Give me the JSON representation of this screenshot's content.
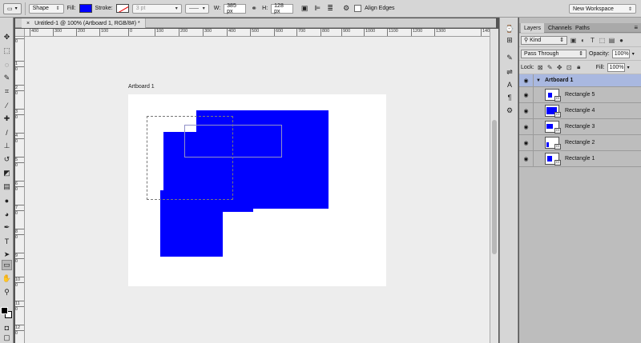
{
  "options_bar": {
    "tool_mode": "Shape",
    "fill_label": "Fill:",
    "stroke_label": "Stroke:",
    "stroke_width": "3 pt",
    "width_label": "W:",
    "width_value": "385 px",
    "height_label": "H:",
    "height_value": "128 px",
    "align_edges_label": "Align Edges",
    "workspace": "New Workspace",
    "fill_color": "#0000ff"
  },
  "document": {
    "tab_title": "Untitled-1 @ 100% (Artboard 1, RGB/8#) *",
    "close_glyph": "×",
    "artboard_label": "Artboard 1"
  },
  "ruler_top": [
    "400",
    "300",
    "200",
    "100",
    "0",
    "100",
    "200",
    "300",
    "400",
    "500",
    "600",
    "700",
    "800",
    "900",
    "1000",
    "1100",
    "1200",
    "1300",
    "140"
  ],
  "ruler_left": [
    "0",
    "1",
    "0",
    "2",
    "0",
    "3",
    "0",
    "4",
    "0",
    "5",
    "0",
    "6",
    "0",
    "7",
    "0",
    "8",
    "0",
    "9",
    "0",
    "10",
    "0",
    "11",
    "0",
    "12",
    "0"
  ],
  "layers_panel": {
    "tabs": [
      "Layers",
      "Channels",
      "Paths"
    ],
    "kind_label": "Kind",
    "blend_mode": "Pass Through",
    "opacity_label": "Opacity:",
    "opacity_value": "100%",
    "lock_label": "Lock:",
    "fill_label": "Fill:",
    "fill_value": "100%",
    "group_name": "Artboard 1",
    "layers": [
      {
        "name": "Rectangle 5"
      },
      {
        "name": "Rectangle 4"
      },
      {
        "name": "Rectangle 3"
      },
      {
        "name": "Rectangle 2"
      },
      {
        "name": "Rectangle 1"
      }
    ]
  },
  "colors": {
    "shape_blue": "#0000ff",
    "panel_bg": "#bdbdbd",
    "group_highlight": "#a9b8e0"
  }
}
